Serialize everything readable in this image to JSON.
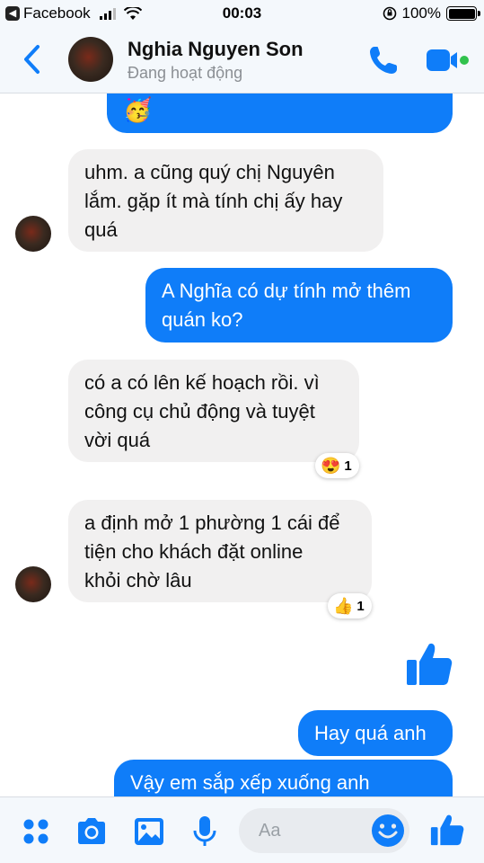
{
  "status_bar": {
    "back_app": "Facebook",
    "time": "00:03",
    "battery": "100%",
    "battery_level": 1.0
  },
  "header": {
    "name": "Nghia Nguyen Son",
    "status": "Đang hoạt động"
  },
  "colors": {
    "accent": "#0f7df9",
    "incoming_bubble": "#f1f0f0",
    "active": "#31c24d"
  },
  "messages": [
    {
      "side": "out",
      "text": "🥳"
    },
    {
      "side": "in",
      "lines": [
        "uhm. a cũng quý chị Nguyên",
        "lắm. gặp ít mà tính chị ấy hay",
        "quá"
      ]
    },
    {
      "side": "out",
      "lines": [
        "A Nghĩa có dự tính mở thêm",
        "quán ko?"
      ]
    },
    {
      "side": "in",
      "lines": [
        "có a có lên kế hoạch rồi. vì",
        "công cụ chủ động và tuyệt",
        "vời quá"
      ],
      "reaction": {
        "emoji": "😍",
        "count": "1"
      }
    },
    {
      "side": "in",
      "lines": [
        "a định mở 1 phường 1 cái để",
        "tiện cho khách đặt online",
        "khỏi chờ lâu"
      ],
      "reaction": {
        "emoji": "👍",
        "count": "1"
      }
    },
    {
      "side": "out",
      "type": "like"
    },
    {
      "side": "out",
      "text": "Hay quá anh"
    },
    {
      "side": "out",
      "text": "Vậy em sắp xếp xuống anh"
    }
  ],
  "composer": {
    "placeholder": "Aa",
    "icons": [
      "menu-dots-icon",
      "camera-icon",
      "image-icon",
      "microphone-icon",
      "smile-icon",
      "thumbs-up-icon"
    ]
  }
}
